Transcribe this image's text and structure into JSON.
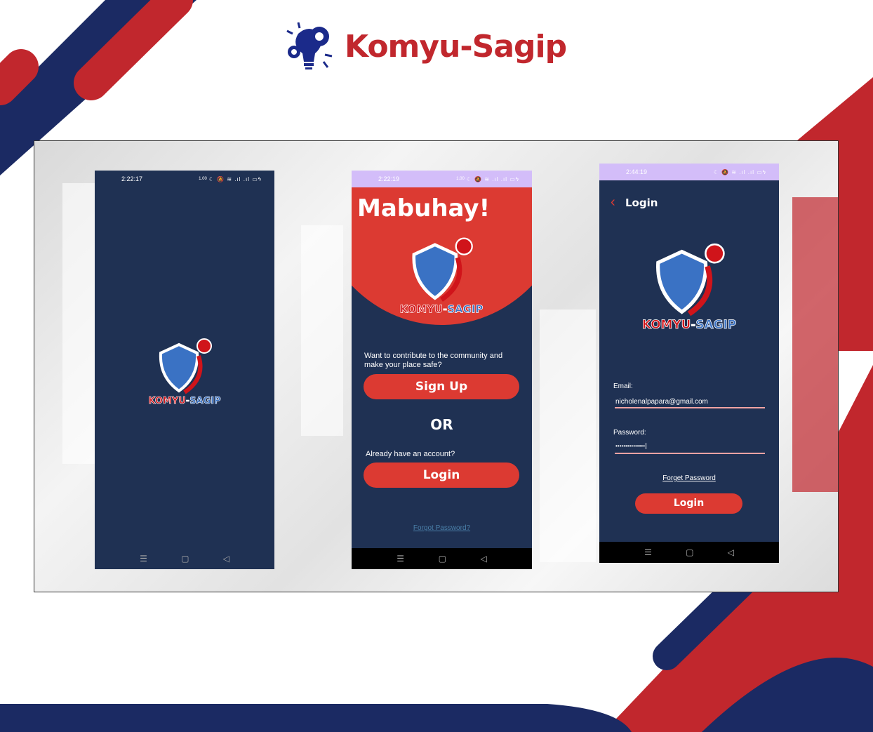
{
  "brand": {
    "name": "Komyu-Sagip",
    "logo_icon": "lightbulb-gears-icon"
  },
  "app_logo_text": {
    "part1": "KOMYU",
    "dash": "-",
    "part2": "SAGIP"
  },
  "colors": {
    "navy": "#1f3153",
    "red": "#dc3a32",
    "brand_red": "#c1272d",
    "status_purple": "#d3bdf9"
  },
  "splash": {
    "time": "2:22:17"
  },
  "welcome": {
    "time": "2:22:19",
    "title": "Mabuhay!",
    "prompt": "Want to contribute to the community and make your place safe?",
    "signup_label": "Sign Up",
    "or_label": "OR",
    "account_prompt": "Already have an account?",
    "login_label": "Login",
    "forgot_label": "Forgot Password?"
  },
  "login": {
    "time": "2:44:19",
    "header": "Login",
    "email_label": "Email:",
    "email_value": "nicholenalpapara@gmail.com",
    "password_label": "Password:",
    "password_value": "•••••••••••••••",
    "forgot_label": "Forget Password",
    "login_label": "Login"
  },
  "statusbar": {
    "icons": "☾ 🔕 ≋ .ıl .ıl ▭ϟ",
    "speed": "1.00"
  },
  "navbar": {
    "menu": "☰",
    "home": "▢",
    "back": "◁"
  }
}
